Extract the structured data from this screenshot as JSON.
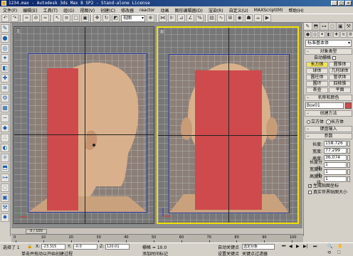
{
  "window": {
    "title": "1234.max - Autodesk 3ds Max 8 SP2 - Stand-alone License",
    "controls": [
      "_",
      "□",
      "×"
    ]
  },
  "menu": [
    "文件(F)",
    "编辑(E)",
    "工具(T)",
    "组(G)",
    "视图(V)",
    "创建(C)",
    "修改器",
    "reactor",
    "动画",
    "图形编辑器(D)",
    "渲染(R)",
    "自定义(U)",
    "MAXScript(M)",
    "帮助(H)"
  ],
  "toolbar": {
    "view_dropdown": "视图",
    "icons": [
      "undo-icon",
      "redo-icon",
      "link-icon",
      "unlink-icon",
      "bind-icon",
      "select-icon",
      "select-by-name-icon",
      "region-icon",
      "move-icon",
      "rotate-icon",
      "scale-icon"
    ]
  },
  "viewports": {
    "left": {
      "label": "左",
      "object": "head-side-reference"
    },
    "front": {
      "label": "前",
      "object": "head-front-reference",
      "active": true
    }
  },
  "command_panel": {
    "object_type_dropdown": "标准基本体",
    "object_type_title": "对象类型",
    "autogrid_label": "自动栅格",
    "primitives": [
      {
        "label": "长方体",
        "active": true
      },
      {
        "label": "圆锥体",
        "active": false
      },
      {
        "label": "球体",
        "active": false
      },
      {
        "label": "几何球体",
        "active": false
      },
      {
        "label": "圆柱体",
        "active": false
      },
      {
        "label": "管状体",
        "active": false
      },
      {
        "label": "圆环",
        "active": false
      },
      {
        "label": "四棱锥",
        "active": false
      },
      {
        "label": "茶壶",
        "active": false
      },
      {
        "label": "平面",
        "active": false
      }
    ],
    "name_color_title": "名称和颜色",
    "name_value": "Box01",
    "name_color": "#cf4a4c",
    "create_method_title": "创建方法",
    "create_method": {
      "cube": "立方体",
      "box": "长方体",
      "selected": "长方体"
    },
    "keyboard_entry_title": "键盘输入",
    "parameters_title": "参数",
    "params": [
      {
        "label": "长度:",
        "value": "158.726"
      },
      {
        "label": "宽度:",
        "value": "77.299"
      },
      {
        "label": "高度:",
        "value": "36.074"
      },
      {
        "label": "长度分段:",
        "value": "1"
      },
      {
        "label": "宽度分段:",
        "value": "1"
      },
      {
        "label": "高度分段:",
        "value": "1"
      }
    ],
    "gen_mapping": "生成贴图坐标",
    "real_world_size": "真实世界贴图大小"
  },
  "timeline": {
    "frame_display": "0 / 100",
    "ticks": [
      "0",
      "10",
      "20",
      "30",
      "40",
      "50",
      "60",
      "70",
      "80",
      "90",
      "100"
    ]
  },
  "status": {
    "selected": "选择了 1",
    "x_label": "X:",
    "x_value": "-23.315",
    "y_label": "Y:",
    "y_value": "-0.0",
    "z_label": "Z:",
    "z_value": "120.01",
    "grid_label": "栅格 = 10.0",
    "autokey_label": "自动关键点",
    "set_key_label": "设置关键点",
    "filter_dropdown": "选定对象",
    "key_filter": "关键点过滤器",
    "prompt": "单击并拖动以开始创建过程",
    "add_time_tag": "添加时间标记"
  }
}
